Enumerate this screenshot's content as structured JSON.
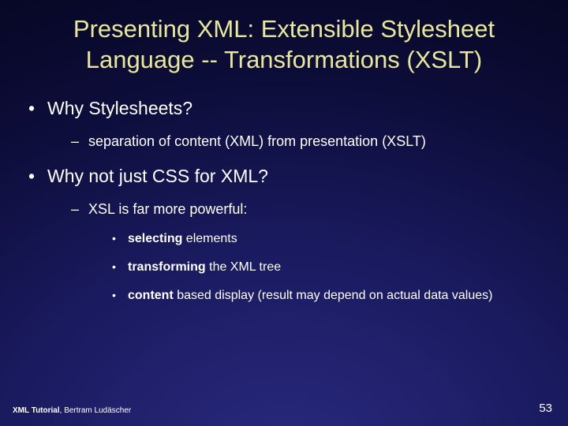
{
  "title": "Presenting XML: Extensible Stylesheet Language -- Transformations (XSLT)",
  "bullets": [
    {
      "label": "Why Stylesheets?",
      "children": [
        {
          "label": "separation of  content (XML) from presentation (XSLT)"
        }
      ]
    },
    {
      "label": "Why not just CSS for XML?",
      "children": [
        {
          "label": "XSL is far more powerful:",
          "children": [
            {
              "bold": "selecting",
              "rest": " elements"
            },
            {
              "bold": "transforming",
              "rest": " the XML tree"
            },
            {
              "bold": "content",
              "rest": " based display (result may depend on actual data values)"
            }
          ]
        }
      ]
    }
  ],
  "footer": {
    "left_bold": "XML Tutorial",
    "left_rest": ", Bertram Ludäscher",
    "page": "53"
  }
}
